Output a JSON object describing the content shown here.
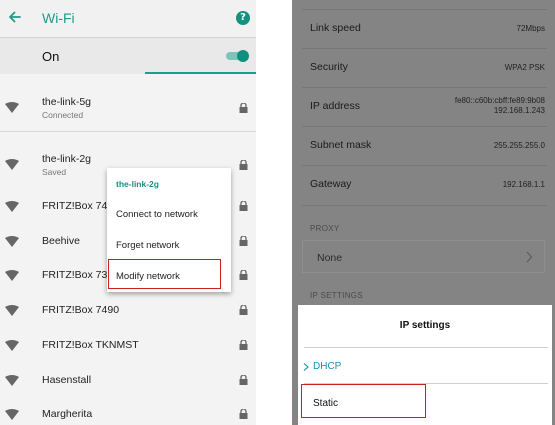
{
  "left": {
    "title": "Wi-Fi",
    "help_glyph": "?",
    "on_label": "On",
    "toggle_on": true,
    "accent": "#1e9a8a",
    "networks": [
      {
        "name": "the-link-5g",
        "status": "Connected"
      },
      {
        "name": "the-link-2g",
        "status": "Saved"
      },
      {
        "name": "FRITZ!Box 743",
        "status": ""
      },
      {
        "name": "Beehive",
        "status": ""
      },
      {
        "name": "FRITZ!Box 736",
        "status": ""
      },
      {
        "name": "FRITZ!Box 7490",
        "status": ""
      },
      {
        "name": "FRITZ!Box TKNMST",
        "status": ""
      },
      {
        "name": "Hasenstall",
        "status": ""
      },
      {
        "name": "Margherita",
        "status": ""
      }
    ],
    "popup": {
      "title": "the-link-2g",
      "items": [
        "Connect to network",
        "Forget network",
        "Modify network"
      ]
    }
  },
  "right": {
    "rows": [
      {
        "key": "Link speed",
        "value": "72Mbps"
      },
      {
        "key": "Security",
        "value": "WPA2 PSK"
      },
      {
        "key": "IP address",
        "value": "fe80::c60b:cbff:fe89:9b08",
        "value2": "192.168.1.243"
      },
      {
        "key": "Subnet mask",
        "value": "255.255.255.0"
      },
      {
        "key": "Gateway",
        "value": "192.168.1.1"
      }
    ],
    "proxy_header": "PROXY",
    "proxy_value": "None",
    "ip_settings_header": "IP SETTINGS",
    "sheet": {
      "title": "IP settings",
      "options": [
        "DHCP",
        "Static"
      ]
    }
  }
}
